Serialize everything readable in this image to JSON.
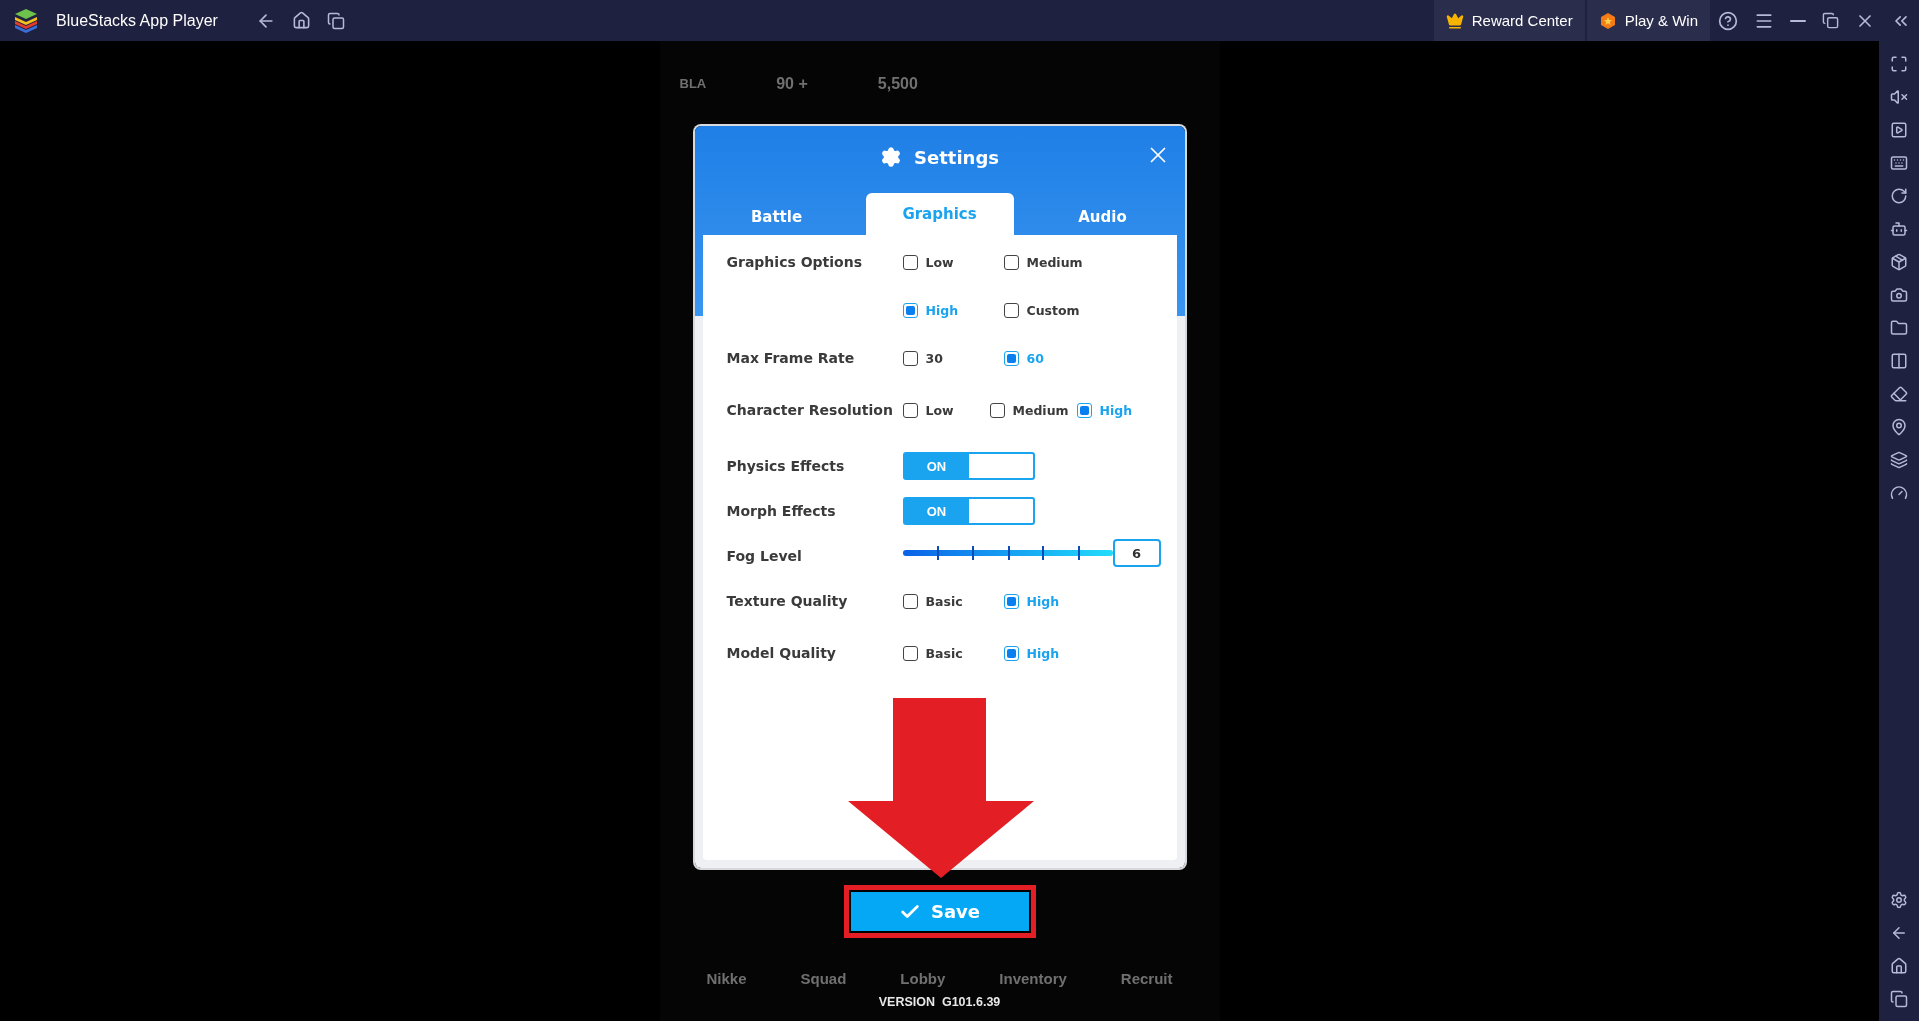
{
  "titlebar": {
    "app_name": "BlueStacks App Player",
    "buttons": [
      {
        "label": "Reward Center",
        "kind": "reward"
      },
      {
        "label": "Play & Win",
        "kind": "play"
      }
    ]
  },
  "game": {
    "hud": {
      "player_tag": "BLA",
      "stat_1": "90 +",
      "stat_2": "5,500"
    },
    "nav": [
      "Nikke",
      "Squad",
      "Lobby",
      "Inventory",
      "Recruit"
    ],
    "version": "VERSION  G101.6.39"
  },
  "dialog": {
    "title": "Settings",
    "tabs": [
      {
        "label": "Battle",
        "selected": false
      },
      {
        "label": "Graphics",
        "selected": true
      },
      {
        "label": "Audio",
        "selected": false
      }
    ],
    "settings": [
      {
        "label": "Graphics Options",
        "kind": "options",
        "options": [
          {
            "label": "Low",
            "checked": false
          },
          {
            "label": "Medium",
            "checked": false
          },
          {
            "label": "High",
            "checked": true
          },
          {
            "label": "Custom",
            "checked": false
          }
        ]
      },
      {
        "label": "Max Frame Rate",
        "kind": "options",
        "options": [
          {
            "label": "30",
            "checked": false
          },
          {
            "label": "60",
            "checked": true
          }
        ]
      },
      {
        "label": "Character Resolution",
        "kind": "options",
        "options": [
          {
            "label": "Low",
            "checked": false
          },
          {
            "label": "Medium",
            "checked": false
          },
          {
            "label": "High",
            "checked": true
          }
        ]
      },
      {
        "label": "Physics Effects",
        "kind": "toggle",
        "on": true,
        "value": "ON"
      },
      {
        "label": "Morph Effects",
        "kind": "toggle",
        "on": true,
        "value": "ON"
      },
      {
        "label": "Fog Level",
        "kind": "slider",
        "level": 1,
        "value": "6"
      },
      {
        "label": "Texture Quality",
        "kind": "options",
        "options": [
          {
            "label": "Basic",
            "checked": false
          },
          {
            "label": "High",
            "checked": true
          }
        ]
      },
      {
        "label": "Model Quality",
        "kind": "options",
        "options": [
          {
            "label": "Basic",
            "checked": false
          },
          {
            "label": "High",
            "checked": true
          }
        ]
      }
    ]
  },
  "save_button": "Save"
}
